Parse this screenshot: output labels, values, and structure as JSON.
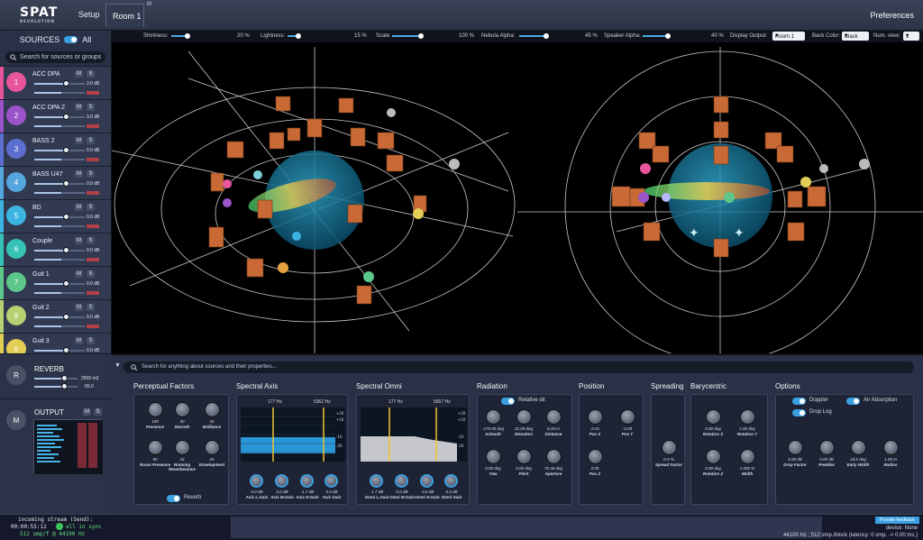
{
  "app": {
    "logo": "SPAT",
    "logo_sub": "REVOLUTION",
    "setup": "Setup",
    "room_tab": "Room 1",
    "room_tab_badge": "M",
    "preferences": "Preferences"
  },
  "sidebar": {
    "header": "SOURCES",
    "all_label": "All",
    "search_placeholder": "Search for sources or groups",
    "sources": [
      {
        "num": "1",
        "name": "ACC DPA",
        "color": "#e8559a",
        "gain": "3.0 dB"
      },
      {
        "num": "2",
        "name": "ACC DPA 2",
        "color": "#9b53c9",
        "gain": "3.0 dB"
      },
      {
        "num": "3",
        "name": "BASS 2",
        "color": "#5c6fd1",
        "gain": "0.0 dB"
      },
      {
        "num": "4",
        "name": "BASS U47",
        "color": "#56a6de",
        "gain": "0.0 dB"
      },
      {
        "num": "5",
        "name": "BD",
        "color": "#3cb4e2",
        "gain": "0.0 dB"
      },
      {
        "num": "6",
        "name": "Couple",
        "color": "#36c3b5",
        "gain": "0.0 dB"
      },
      {
        "num": "7",
        "name": "Guit 1",
        "color": "#5dc78b",
        "gain": "0.0 dB"
      },
      {
        "num": "8",
        "name": "Guit 2",
        "color": "#b6d072",
        "gain": "0.0 dB"
      },
      {
        "num": "9",
        "name": "Guit 3",
        "color": "#e3cd55",
        "gain": "0.0 dB"
      }
    ],
    "m": "M",
    "s": "S",
    "reverb": {
      "badge": "R",
      "name": "REVERB",
      "v1": "2500 m3",
      "v2": "65.0"
    },
    "output": {
      "badge": "M",
      "name": "OUTPUT",
      "gain": "0.0 dB"
    }
  },
  "viewport": {
    "shininess_label": "Shininess:",
    "shininess": "20 %",
    "lightness_label": "Lightness:",
    "lightness": "15 %",
    "scale_label": "Scale:",
    "scale": "100 %",
    "nebula_label": "Nebula Alpha:",
    "nebula": "45 %",
    "speaker_label": "Speaker Alpha:",
    "speaker": "40 %",
    "display_label": "Display Output:",
    "display": "Room 1",
    "backcolor_label": "Back Color:",
    "backcolor": "Black",
    "numview_label": "Num. view:",
    "numview": "2"
  },
  "bottom": {
    "search_placeholder": "Search for anything about sources and their properties...",
    "perceptual": {
      "title": "Perceptual Factors",
      "knobs": [
        {
          "v": "100",
          "l": "Presence"
        },
        {
          "v": "30",
          "l": "Warmth"
        },
        {
          "v": "30",
          "l": "Brilliance"
        },
        {
          "v": "50",
          "l": "Room Presence"
        },
        {
          "v": "34",
          "l": "Running Reverberance"
        },
        {
          "v": "25",
          "l": "Envelopment"
        }
      ],
      "reverb_label": "Reverb"
    },
    "spectral_axis": {
      "title": "Spectral Axis",
      "f1": "177 Hz",
      "f2": "5362 Hz",
      "knobs": [
        {
          "v": "0.0 dB",
          "l": "Axis L.Gain"
        },
        {
          "v": "0.0 dB",
          "l": "Axis M.Gain"
        },
        {
          "v": "-1.7 dB",
          "l": "Axis H.Gain"
        },
        {
          "v": "0.0 dB",
          "l": "Axis Gain"
        }
      ]
    },
    "spectral_omni": {
      "title": "Spectral Omni",
      "f1": "177 Hz",
      "f2": "5657 Hz",
      "knobs": [
        {
          "v": "-1.7 dB",
          "l": "Omni L.Gain"
        },
        {
          "v": "0.0 dB",
          "l": "Omni M.Gain"
        },
        {
          "v": "-3.6 dB",
          "l": "Omni H.Gain"
        },
        {
          "v": "0.0 dB",
          "l": "Omni Gain"
        }
      ]
    },
    "radiation": {
      "title": "Radiation",
      "relative": "Relative dir.",
      "knobs": [
        {
          "v": "-175.95 deg",
          "l": "Azimuth"
        },
        {
          "v": "31.09 deg",
          "l": "Elevation"
        },
        {
          "v": "8.18 m",
          "l": "Distance"
        },
        {
          "v": "0.00 deg",
          "l": "Yaw"
        },
        {
          "v": "0.00 deg",
          "l": "Pitch"
        },
        {
          "v": "70.36 deg",
          "l": "Aperture"
        }
      ]
    },
    "position": {
      "title": "Position",
      "knobs": [
        {
          "v": "-0.01",
          "l": "Pos X"
        },
        {
          "v": "-0.09",
          "l": "Pos Y"
        },
        {
          "v": "0.05",
          "l": "Pos Z"
        }
      ]
    },
    "spreading": {
      "title": "Spreading",
      "knobs": [
        {
          "v": "0.0 %",
          "l": "Spread Factor"
        }
      ]
    },
    "barycentric": {
      "title": "Barycentric",
      "knobs": [
        {
          "v": "0.00 deg",
          "l": "Rotation X"
        },
        {
          "v": "2.00 deg",
          "l": "Rotation Y"
        },
        {
          "v": "0.00 deg",
          "l": "Rotation Z"
        },
        {
          "v": "1.000 %",
          "l": "Width"
        }
      ]
    },
    "options": {
      "title": "Options",
      "doppler": "Doppler",
      "air": "Air Absorption",
      "droplog": "Drop Log",
      "knobs": [
        {
          "v": "6.00 dB",
          "l": "Drop Factor"
        },
        {
          "v": "0.00 dB",
          "l": "Preddiw"
        },
        {
          "v": "18.0 deg",
          "l": "Early Width"
        },
        {
          "v": "1.00 m",
          "l": "Radius"
        }
      ]
    }
  },
  "status": {
    "stream_label": "incoming stream (Send):",
    "time": "00:00:55:12",
    "sync": "all in sync",
    "rate": "512 smp/f @ 44100 Hz",
    "feedback": "Provide feedback",
    "device": "device: None",
    "info": "44100 Hz ; 512 smp./block (latency: 0 smp. -> 0.00 ms.)"
  }
}
